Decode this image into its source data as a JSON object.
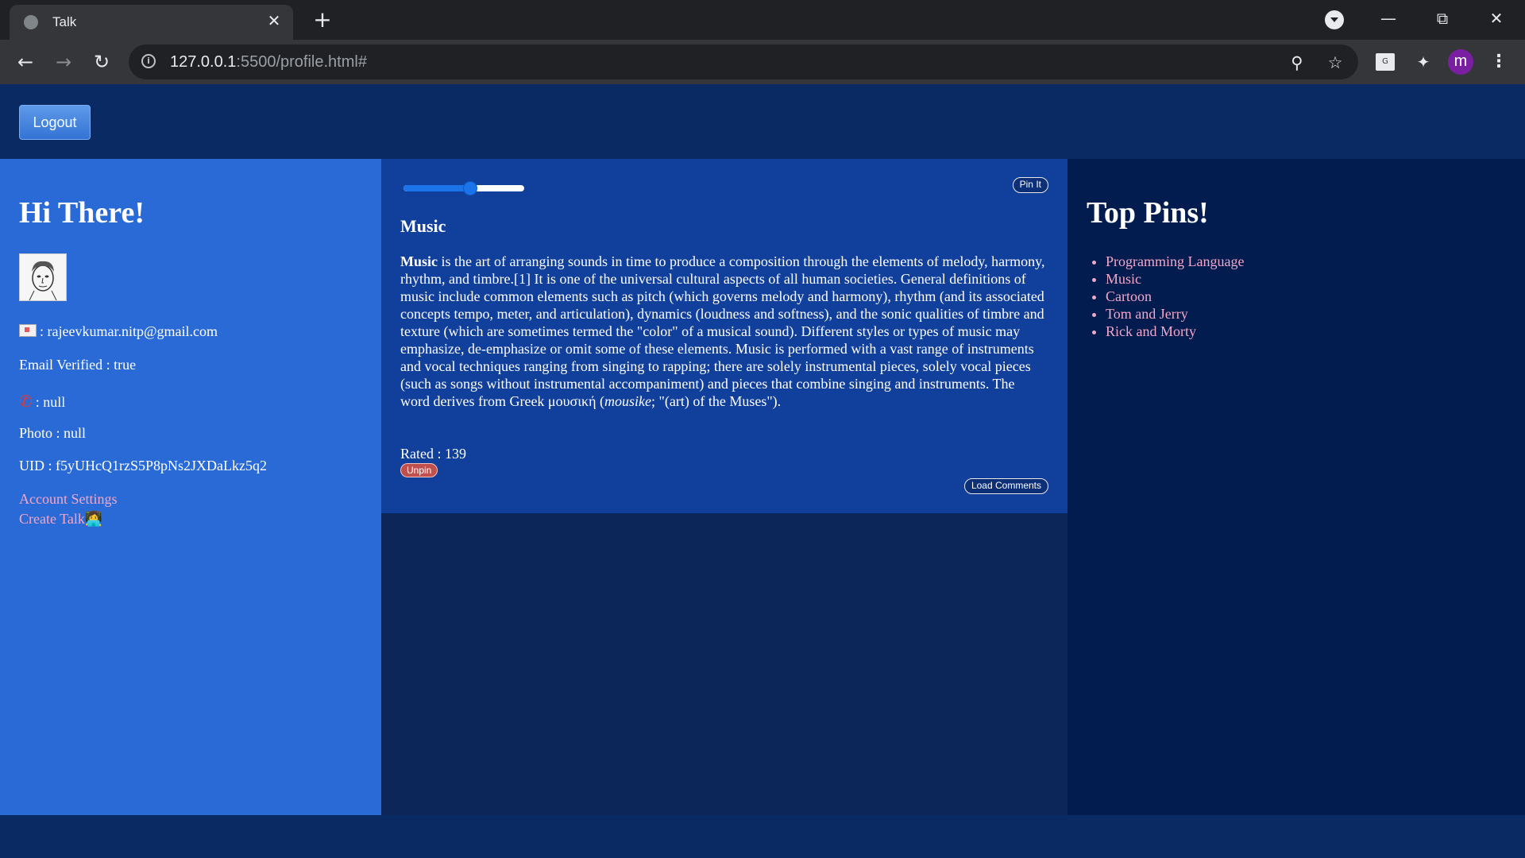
{
  "browser": {
    "tab_title": "Talk",
    "close_glyph": "✕",
    "new_tab_glyph": "+",
    "url_host": "127.0.0.1",
    "url_rest": ":5500/profile.html#",
    "avatar_letter": "m",
    "icons": [
      "globe-icon",
      "close-icon",
      "new-tab-icon",
      "tab-search-icon",
      "minimize-icon",
      "restore-icon",
      "window-close-icon",
      "back-icon",
      "forward-icon",
      "reload-icon",
      "info-icon",
      "zoom-icon",
      "star-icon",
      "extension-box-icon",
      "puzzle-icon",
      "menu-icon"
    ]
  },
  "header": {
    "logout_label": "Logout"
  },
  "profile": {
    "greeting": "Hi There!",
    "email": ": rajeevkumar.nitp@gmail.com",
    "email_verified": "Email Verified : true",
    "phone": ": null",
    "photo": "Photo : null",
    "uid": "UID : f5yUHcQ1rzS5P8pNs2JXDaLkz5q2",
    "account_settings": "Account Settings",
    "create_talk": "Create Talk",
    "create_talk_emoji": "👩‍💻"
  },
  "talk": {
    "slider_level": 0.55,
    "pin_label": "Pin It",
    "title": "Music",
    "body_bold": "Music",
    "body_1": " is the art of arranging sounds in time to produce a composition through the elements of melody, harmony, rhythm, and timbre.[1] It is one of the universal cultural aspects of all human societies. General definitions of music include common elements such as pitch (which governs melody and harmony), rhythm (and its associated concepts tempo, meter, and articulation), dynamics (loudness and softness), and the sonic qualities of timbre and texture (which are sometimes termed the \"color\" of a musical sound). Different styles or types of music may emphasize, de-emphasize or omit some of these elements. Music is performed with a vast range of instruments and vocal techniques ranging from singing to rapping; there are solely instrumental pieces, solely vocal pieces (such as songs without instrumental accompaniment) and pieces that combine singing and instruments. The word derives from Greek μουσική (",
    "body_italic": "mousike",
    "body_2": "; \"(art) of the Muses\").",
    "rated": "Rated : 139",
    "unpin_label": "Unpin",
    "load_comments_label": "Load Comments"
  },
  "top_pins": {
    "title": "Top Pins!",
    "items": [
      "Programming Language",
      "Music",
      "Cartoon",
      "Tom and Jerry",
      "Rick and Morty"
    ]
  },
  "colors": {
    "left_panel": "#2a6ad6",
    "card": "#113f9c",
    "right_panel": "#021c4f",
    "page": "#0a2a63",
    "link": "#f4a7c6",
    "unpin": "#c0504d"
  }
}
